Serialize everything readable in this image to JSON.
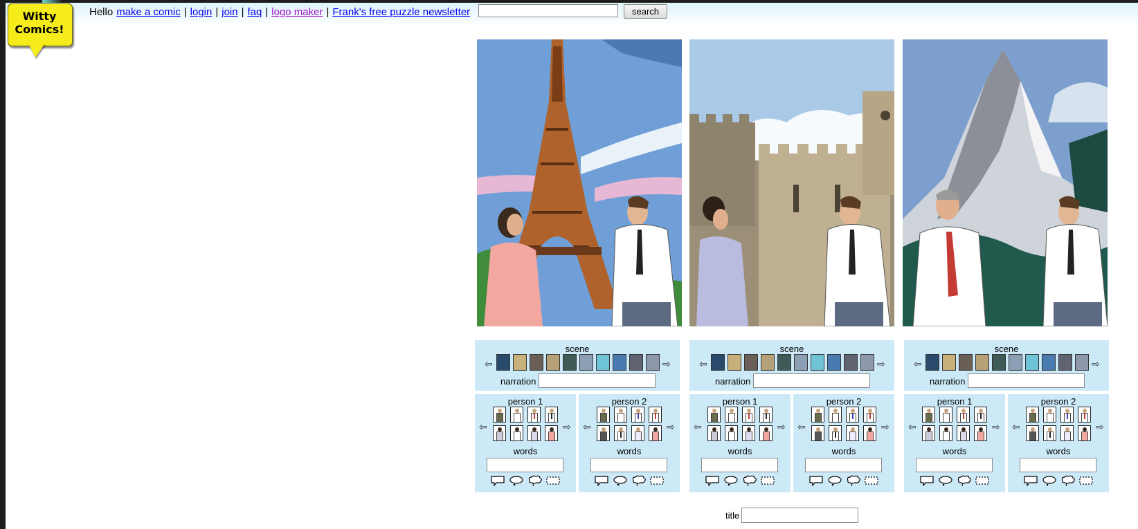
{
  "logo": {
    "line1": "Witty",
    "line2": "Comics!"
  },
  "nav": {
    "greeting": "Hello",
    "links": [
      "make a comic",
      "login",
      "join",
      "faq",
      "logo maker",
      "Frank's free puzzle newsletter"
    ],
    "separator": "|",
    "search_placeholder": "",
    "search_button": "search"
  },
  "controls": {
    "scene_label": "scene",
    "narration_label": "narration",
    "person1_label": "person 1",
    "person2_label": "person 2",
    "words_label": "words",
    "left_arrow": "⇦",
    "right_arrow": "⇨"
  },
  "title": {
    "label": "title",
    "value": ""
  },
  "colors": {
    "control_bg": "#cce9f8",
    "link": "#0000ee",
    "visited_link": "#a010c8",
    "logo_yellow": "#f7ec1b"
  },
  "panels": [
    {
      "scene": "eiffel-tower",
      "characters": [
        "woman-pink-suit",
        "man-white-shirt"
      ]
    },
    {
      "scene": "castle",
      "characters": [
        "woman-lavender-suit",
        "man-white-shirt"
      ]
    },
    {
      "scene": "matterhorn",
      "characters": [
        "man-red-tie",
        "man-white-shirt"
      ]
    }
  ],
  "icons": [
    "speech-bubble-icon",
    "whisper-bubble-icon",
    "thought-bubble-icon",
    "narration-box-icon",
    "left-arrow-icon",
    "right-arrow-icon"
  ]
}
